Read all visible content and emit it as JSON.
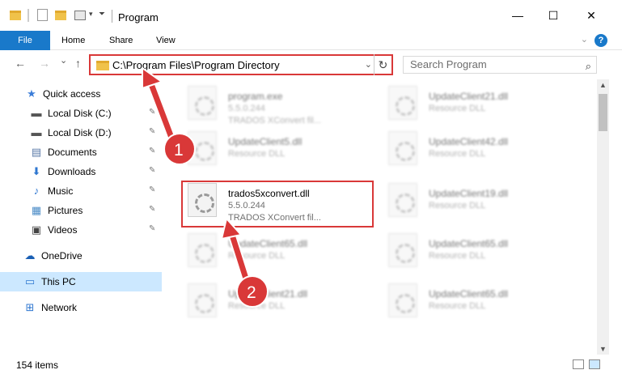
{
  "titlebar": {
    "title": "Program",
    "minimize": "—",
    "maximize": "☐",
    "close": "✕"
  },
  "ribbon": {
    "tabs": [
      "File",
      "Home",
      "Share",
      "View"
    ],
    "collapse": "⌄",
    "help": "?"
  },
  "nav": {
    "back": "←",
    "forward": "→",
    "recent": "⌄",
    "up": "↑",
    "address": "C:\\Program Files\\Program Directory",
    "address_dropdown": "⌄",
    "refresh": "↻",
    "search_placeholder": "Search Program",
    "search_icon": "⌕"
  },
  "sidebar": {
    "items": [
      {
        "label": "Quick access",
        "icon": "star-icon",
        "glyph": "★",
        "color": "#3b7dd8"
      },
      {
        "label": "Local Disk (C:)",
        "icon": "drive-icon",
        "glyph": "▬",
        "color": "#555555",
        "pinned": true
      },
      {
        "label": "Local Disk (D:)",
        "icon": "drive-icon",
        "glyph": "▬",
        "color": "#555555",
        "pinned": true
      },
      {
        "label": "Documents",
        "icon": "document-icon",
        "glyph": "▤",
        "color": "#5a7aa8",
        "pinned": true
      },
      {
        "label": "Downloads",
        "icon": "download-icon",
        "glyph": "⬇",
        "color": "#2f77d0",
        "pinned": true
      },
      {
        "label": "Music",
        "icon": "music-icon",
        "glyph": "♪",
        "color": "#2f77d0",
        "pinned": true
      },
      {
        "label": "Pictures",
        "icon": "picture-icon",
        "glyph": "▦",
        "color": "#4a8bc6",
        "pinned": true
      },
      {
        "label": "Videos",
        "icon": "video-icon",
        "glyph": "▣",
        "color": "#444444",
        "pinned": true
      },
      {
        "label": "OneDrive",
        "icon": "cloud-icon",
        "glyph": "☁",
        "color": "#1a5fb4"
      },
      {
        "label": "This PC",
        "icon": "computer-icon",
        "glyph": "▭",
        "color": "#2f77d0",
        "selected": true
      },
      {
        "label": "Network",
        "icon": "network-icon",
        "glyph": "⊞",
        "color": "#2f77d0"
      }
    ],
    "pin_glyph": "📌"
  },
  "files": [
    {
      "name": "program.exe",
      "version": "5.5.0.244",
      "desc": "TRADOS XConvert fil...",
      "blurred": true
    },
    {
      "name": "UpdateClient21.dll",
      "version": "Resource DLL",
      "desc": "",
      "blurred": true
    },
    {
      "name": "UpdateClient5.dll",
      "version": "Resource DLL",
      "desc": "",
      "blurred": true
    },
    {
      "name": "UpdateClient42.dll",
      "version": "Resource DLL",
      "desc": "",
      "blurred": true
    },
    {
      "name": "trados5xconvert.dll",
      "version": "5.5.0.244",
      "desc": "TRADOS XConvert fil...",
      "blurred": false
    },
    {
      "name": "UpdateClient19.dll",
      "version": "Resource DLL",
      "desc": "",
      "blurred": true
    },
    {
      "name": "UpdateClient65.dll",
      "version": "Resource DLL",
      "desc": "",
      "blurred": true
    },
    {
      "name": "UpdateClient65.dll",
      "version": "Resource DLL",
      "desc": "",
      "blurred": true
    },
    {
      "name": "UpdateClient21.dll",
      "version": "Resource DLL",
      "desc": "",
      "blurred": true
    },
    {
      "name": "UpdateClient65.dll",
      "version": "Resource DLL",
      "desc": "",
      "blurred": true
    }
  ],
  "status": {
    "items": "154 items"
  },
  "annotations": {
    "step1": "1",
    "step2": "2",
    "color": "#d93838"
  }
}
